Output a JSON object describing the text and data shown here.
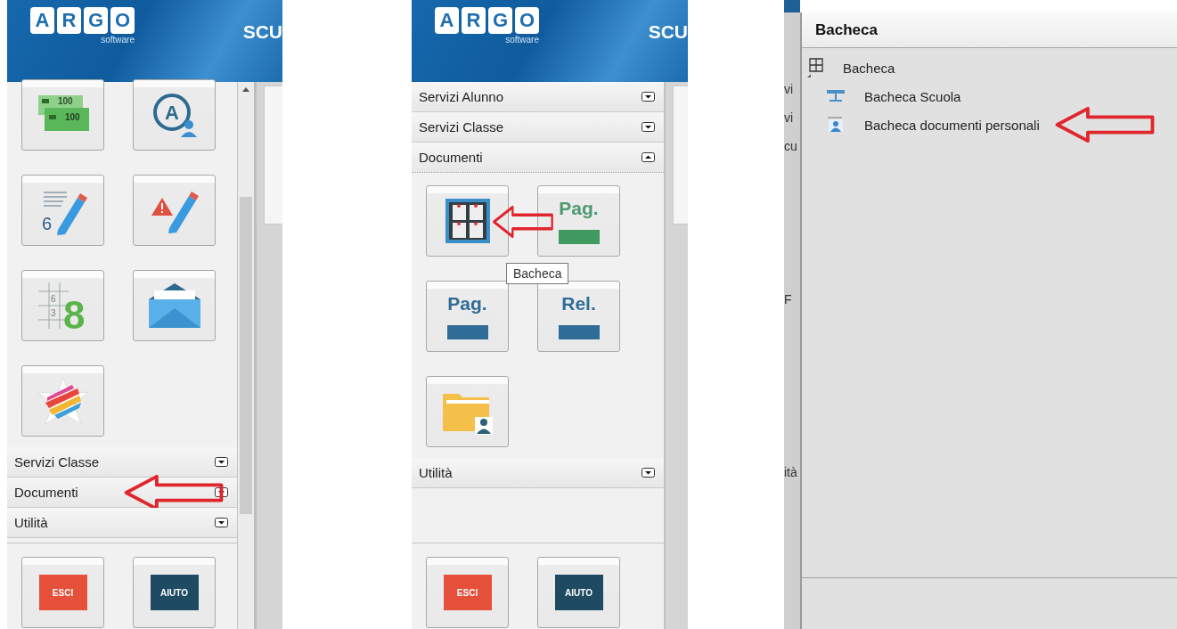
{
  "panels": [
    {
      "kind": "sidebar",
      "scrollbar": true,
      "header": {
        "logo_letters": [
          "A",
          "R",
          "G",
          "O"
        ],
        "logo_sub": "software",
        "title": "SCU"
      },
      "blocks": [
        {
          "kind": "tiles",
          "tiles": [
            {
              "kind": "money",
              "glyphs": [
                "100",
                "100"
              ],
              "highlighted": false
            },
            {
              "kind": "avatar",
              "glyphs": [
                "A"
              ],
              "highlighted": false
            },
            {
              "kind": "grades",
              "glyphs": [
                "6"
              ],
              "highlighted": false
            },
            {
              "kind": "alert",
              "highlighted": false
            },
            {
              "kind": "grid",
              "glyphs": [
                "6",
                "3",
                "8"
              ],
              "highlighted": false
            },
            {
              "kind": "envelope",
              "highlighted": false
            },
            {
              "kind": "star",
              "highlighted": false
            }
          ]
        },
        {
          "kind": "section",
          "label": "Servizi Classe",
          "expanded": false,
          "highlighted": false
        },
        {
          "kind": "section",
          "label": "Documenti",
          "expanded": false,
          "highlighted": true
        },
        {
          "kind": "section",
          "label": "Utilità",
          "expanded": false,
          "highlighted": false
        }
      ],
      "footer_tiles": [
        {
          "kind": "exit",
          "label": "ESCI",
          "highlighted": false
        },
        {
          "kind": "help",
          "label": "AIUTO",
          "highlighted": false
        }
      ]
    },
    {
      "kind": "sidebar",
      "scrollbar": false,
      "header": {
        "logo_letters": [
          "A",
          "R",
          "G",
          "O"
        ],
        "logo_sub": "software",
        "title": "SCU"
      },
      "blocks": [
        {
          "kind": "section",
          "label": "Servizi Alunno",
          "expanded": false,
          "highlighted": false
        },
        {
          "kind": "section",
          "label": "Servizi Classe",
          "expanded": false,
          "highlighted": false
        },
        {
          "kind": "section",
          "label": "Documenti",
          "expanded": true,
          "highlighted": false
        },
        {
          "kind": "tiles",
          "tiles": [
            {
              "kind": "board",
              "highlighted": true,
              "tooltip": "Bacheca"
            },
            {
              "kind": "pag_green",
              "label": "Pag.",
              "highlighted": false
            },
            {
              "kind": "pag_blue",
              "label": "Pag.",
              "highlighted": false
            },
            {
              "kind": "rel",
              "label": "Rel.",
              "highlighted": false
            },
            {
              "kind": "folder",
              "highlighted": false
            }
          ]
        },
        {
          "kind": "section",
          "label": "Utilità",
          "expanded": false,
          "highlighted": false
        }
      ],
      "footer_tiles": [
        {
          "kind": "exit",
          "label": "ESCI",
          "highlighted": false
        },
        {
          "kind": "help",
          "label": "AIUTO",
          "highlighted": false
        }
      ]
    },
    {
      "kind": "window",
      "title": "Bacheca",
      "background_texts": [
        "vi",
        "vi",
        "cu",
        "F",
        "ità"
      ],
      "tree": [
        {
          "label": "Bacheca",
          "kind": "grid",
          "expanded": true,
          "highlighted": false,
          "children": [
            {
              "label": "Bacheca Scuola",
              "kind": "board",
              "highlighted": false
            },
            {
              "label": "Bacheca documenti personali",
              "kind": "user",
              "highlighted": true
            }
          ]
        }
      ]
    }
  ]
}
